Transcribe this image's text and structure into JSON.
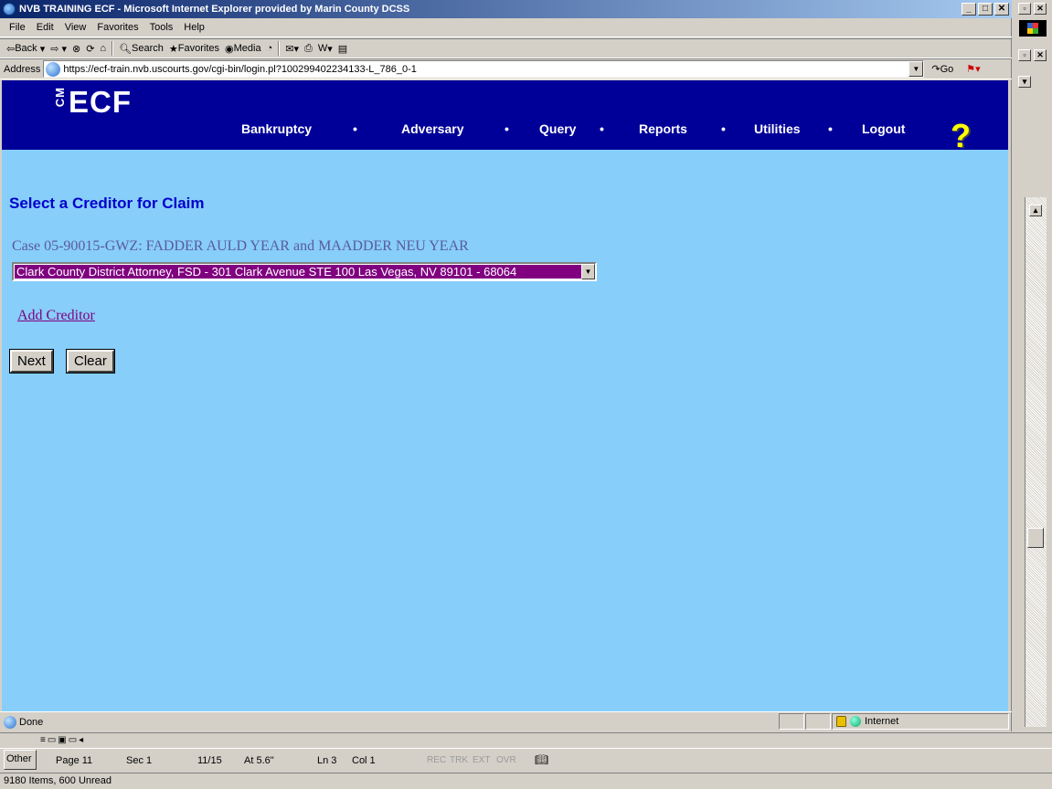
{
  "window": {
    "title": "NVB TRAINING ECF - Microsoft Internet Explorer provided by Marin County DCSS"
  },
  "menu": [
    "File",
    "Edit",
    "View",
    "Favorites",
    "Tools",
    "Help"
  ],
  "toolbar": {
    "back": "Back",
    "search": "Search",
    "favorites": "Favorites",
    "media": "Media"
  },
  "address": {
    "label": "Address",
    "url": "https://ecf-train.nvb.uscourts.gov/cgi-bin/login.pl?100299402234133-L_786_0-1",
    "go": "Go"
  },
  "ecf": {
    "logo": "ECF",
    "logo_prefix": "CM",
    "nav": [
      "Bankruptcy",
      "Adversary",
      "Query",
      "Reports",
      "Utilities",
      "Logout"
    ],
    "nav_separator": "•",
    "help": "?"
  },
  "page": {
    "title": "Select a Creditor for Claim",
    "case_caption": "Case 05-90015-GWZ: FADDER AULD YEAR and MAADDER NEU YEAR",
    "creditor_selected": "Clark County District Attorney, FSD - 301 Clark Avenue STE 100 Las Vegas, NV 89101 - 68064",
    "add_creditor": "Add Creditor",
    "next_button": "Next",
    "clear_button": "Clear"
  },
  "status": {
    "text": "Done",
    "zone": "Internet"
  },
  "word_status": {
    "other": "Other",
    "page": "Page 11",
    "sec": "Sec 1",
    "pages": "11/15",
    "at": "At 5.6\"",
    "ln": "Ln 3",
    "col": "Col 1",
    "rec": "REC",
    "trk": "TRK",
    "ext": "EXT",
    "ovr": "OVR"
  },
  "outlook_status": "9180 Items, 600 Unread"
}
